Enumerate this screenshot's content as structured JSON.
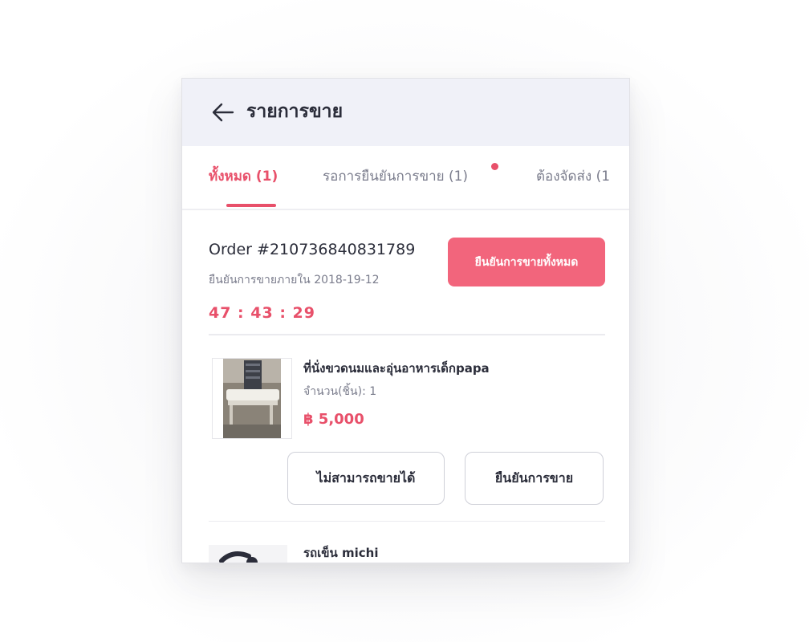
{
  "header": {
    "title": "รายการขาย",
    "back_icon": "arrow-left-icon"
  },
  "tabs": [
    {
      "label": "ทั้งหมด (1)",
      "active": true
    },
    {
      "label": "รอการยืนยันการขาย (1)",
      "active": false,
      "has_notification_dot": true
    },
    {
      "label": "ต้องจัดส่ง (1",
      "active": false
    }
  ],
  "order": {
    "id_text": "Order #210736840831789",
    "deadline_text": "ยืนยันการขายภายใน 2018-19-12",
    "countdown": "47 : 43 : 29",
    "confirm_all_label": "ยืนยันการขายทั้งหมด"
  },
  "products": [
    {
      "name": "ที่นั่งขวดนมและอุ่นอาหารเด็กpapa",
      "quantity_text": "จำนวน(ชิ้น): 1",
      "price": "฿ 5,000",
      "cannot_sell_label": "ไม่สามารถขายได้",
      "confirm_sale_label": "ยืนยันการขาย"
    },
    {
      "name": "รถเข็น michi"
    }
  ],
  "colors": {
    "accent": "#e8506a",
    "button_fill": "#f2657c",
    "header_bg": "#f0f1f8",
    "text_dark": "#2b2d3a",
    "text_muted": "#7a7c8c"
  }
}
